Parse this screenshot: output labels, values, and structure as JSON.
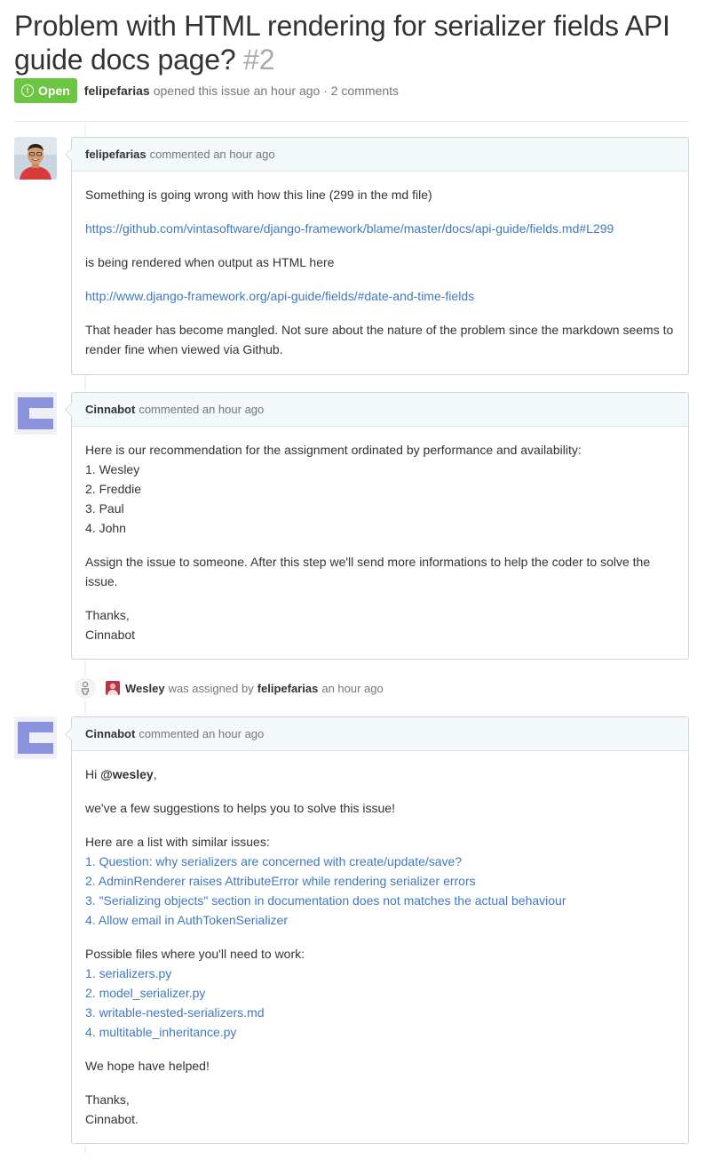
{
  "issue": {
    "title": "Problem with HTML rendering for serializer fields API guide docs page?",
    "number": "#2",
    "status": "Open",
    "author": "felipefarias",
    "meta_text": "opened this issue an hour ago · 2 comments"
  },
  "comments": [
    {
      "author": "felipefarias",
      "time": "commented an hour ago",
      "p1": "Something is going wrong with how this line (299 in the md file)",
      "link1": "https://github.com/vintasoftware/django-framework/blame/master/docs/api-guide/fields.md#L299",
      "p2": "is being rendered when output as HTML here",
      "link2": "http://www.django-framework.org/api-guide/fields/#date-and-time-fields",
      "p3": "That header has become mangled. Not sure about the nature of the problem since the markdown seems to render fine when viewed via Github."
    },
    {
      "author": "Cinnabot",
      "time": "commented an hour ago",
      "intro": "Here is our recommendation for the assignment ordinated by performance and availability:",
      "list": [
        "1. Wesley",
        "2. Freddie",
        "3. Paul",
        "4. John"
      ],
      "p2": "Assign the issue to someone. After this step we'll send more informations to help the coder to solve the issue.",
      "thanks": "Thanks,",
      "sign": "Cinnabot"
    },
    {
      "author": "Cinnabot",
      "time": "commented an hour ago",
      "hi": "Hi",
      "mention": "@wesley",
      "comma": ",",
      "p2": "we've a few suggestions to helps you to solve this issue!",
      "similar_intro": "Here are a list with similar issues:",
      "similar": [
        "1. Question: why serializers are concerned with create/update/save?",
        "2. AdminRenderer raises AttributeError while rendering serializer errors",
        "3. \"Serializing objects\" section in documentation does not matches the actual behaviour",
        "4. Allow email in AuthTokenSerializer"
      ],
      "files_intro": "Possible files where you'll need to work:",
      "files": [
        "1. serializers.py",
        "2. model_serializer.py",
        "3. writable-nested-serializers.md",
        "4. multitable_inheritance.py"
      ],
      "hope": "We hope have helped!",
      "thanks": "Thanks,",
      "sign": "Cinnabot."
    }
  ],
  "event": {
    "assignee": "Wesley",
    "text": "was assigned by",
    "actor": "felipefarias",
    "time": "an hour ago"
  },
  "colors": {
    "open_badge": "#6cc644",
    "link": "#4078c0",
    "bot_logo": "#8b93dc",
    "header_bg": "#f3f8fb"
  }
}
